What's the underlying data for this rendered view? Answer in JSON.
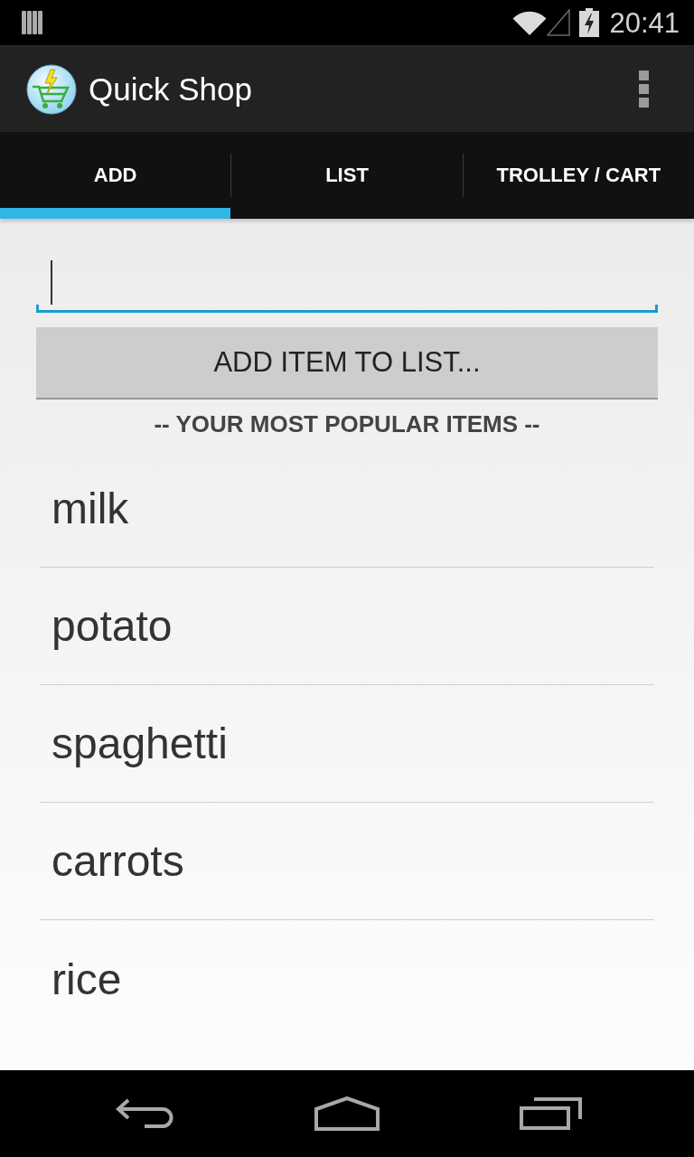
{
  "status_bar": {
    "time": "20:41"
  },
  "action_bar": {
    "title": "Quick Shop"
  },
  "tabs": [
    {
      "label": "ADD",
      "selected": true
    },
    {
      "label": "LIST",
      "selected": false
    },
    {
      "label": "TROLLEY / CART",
      "selected": false
    }
  ],
  "item_field": {
    "focused": true
  },
  "add_button": {
    "label": "ADD ITEM TO LIST..."
  },
  "popular_items": {
    "header": "-- YOUR MOST POPULAR ITEMS --",
    "items": [
      "milk",
      "potato",
      "spaghetti",
      "carrots",
      "rice"
    ]
  }
}
